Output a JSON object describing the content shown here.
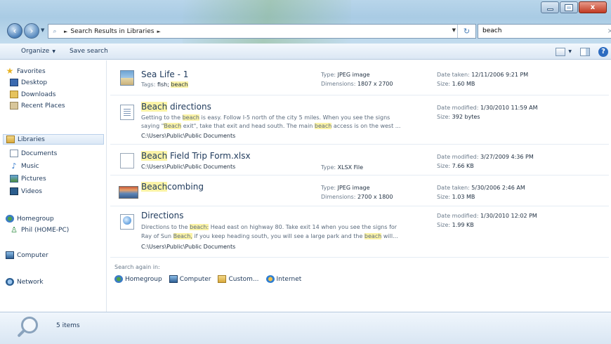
{
  "window": {
    "minimize": "–",
    "maximize": "□",
    "close": "x"
  },
  "address": {
    "search_icon": "search-icon",
    "location": "Search Results in Libraries",
    "search_value": "beach"
  },
  "toolbar": {
    "organize": "Organize",
    "save_search": "Save search"
  },
  "sidebar": {
    "favorites": {
      "label": "Favorites",
      "items": [
        "Desktop",
        "Downloads",
        "Recent Places"
      ]
    },
    "libraries": {
      "label": "Libraries",
      "items": [
        "Documents",
        "Music",
        "Pictures",
        "Videos"
      ]
    },
    "homegroup": {
      "label": "Homegroup",
      "items": [
        "Phil (HOME-PC)"
      ]
    },
    "computer": "Computer",
    "network": "Network"
  },
  "results": [
    {
      "title_pre": "",
      "title_hl": "",
      "title_post": "Sea Life - 1",
      "tags_label": "Tags:",
      "tags_pre": "fish; ",
      "tags_hl": "beach",
      "type_label": "Type:",
      "type": "JPEG image",
      "dim_label": "Dimensions:",
      "dim": "1807 x 2700",
      "date_label": "Date taken:",
      "date": "12/11/2006 9:21 PM",
      "size_label": "Size:",
      "size": "1.60 MB"
    },
    {
      "title_pre": "",
      "title_hl": "Beach",
      "title_post": " directions",
      "s1_a": "Getting to the ",
      "s1_hl": "beach",
      "s1_b": " is easy. Follow I-5 north of the city 5 miles. When you see the signs",
      "s2_a": "saying \"",
      "s2_hl1": "Beach",
      "s2_b": " exit\", take that exit and head south. The main ",
      "s2_hl2": "beach",
      "s2_c": " access is on the west ...",
      "path": "C:\\Users\\Public\\Public Documents",
      "date_label": "Date modified:",
      "date": "1/30/2010 11:59 AM",
      "size_label": "Size:",
      "size": "392 bytes"
    },
    {
      "title_pre": "",
      "title_hl": "Beach",
      "title_post": " Field Trip Form.xlsx",
      "path": "C:\\Users\\Public\\Public Documents",
      "type_label": "Type:",
      "type": "XLSX File",
      "date_label": "Date modified:",
      "date": "3/27/2009 4:36 PM",
      "size_label": "Size:",
      "size": "7.66 KB"
    },
    {
      "title_pre": "",
      "title_hl": "Beach",
      "title_post": "combing",
      "type_label": "Type:",
      "type": "JPEG image",
      "dim_label": "Dimensions:",
      "dim": "2700 x 1800",
      "date_label": "Date taken:",
      "date": "5/30/2006 2:46 AM",
      "size_label": "Size:",
      "size": "1.03 MB"
    },
    {
      "title_pre": "",
      "title_hl": "",
      "title_post": "Directions",
      "s1_a": "Directions to the ",
      "s1_hl": "beach:",
      "s1_b": " Head east on highway 80. Take exit 14 when you see the signs for",
      "s2_a": "Ray of Sun ",
      "s2_hl1": "Beach,",
      "s2_b": " if you keep heading south, you will see a large park and the ",
      "s2_hl2": "beach",
      "s2_c": " will...",
      "path": "C:\\Users\\Public\\Public Documents",
      "date_label": "Date modified:",
      "date": "1/30/2010 12:02 PM",
      "size_label": "Size:",
      "size": "1.99 KB"
    }
  ],
  "search_again": {
    "label": "Search again in:",
    "links": [
      "Homegroup",
      "Computer",
      "Custom...",
      "Internet"
    ]
  },
  "status": {
    "count": "5 items"
  }
}
